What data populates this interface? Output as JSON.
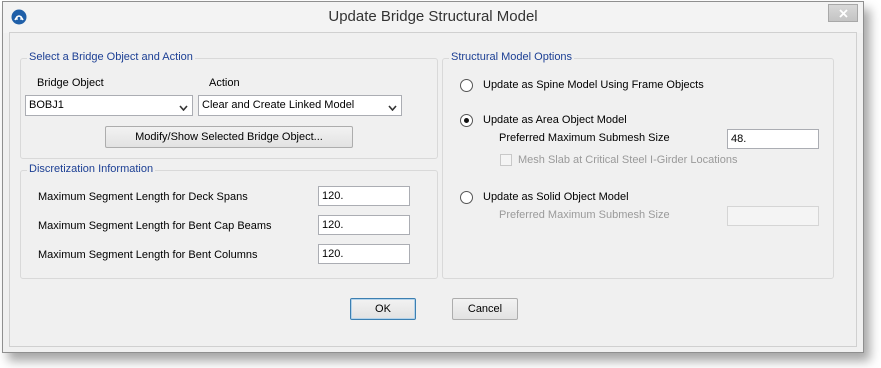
{
  "window": {
    "title": "Update Bridge Structural Model"
  },
  "select_group": {
    "legend": "Select a Bridge Object and Action",
    "bridge_object_label": "Bridge Object",
    "bridge_object_value": "BOBJ1",
    "action_label": "Action",
    "action_value": "Clear and Create Linked Model",
    "modify_button": "Modify/Show Selected Bridge Object..."
  },
  "discretization": {
    "legend": "Discretization Information",
    "rows": [
      {
        "label": "Maximum Segment Length for Deck Spans",
        "value": "120."
      },
      {
        "label": "Maximum Segment Length for Bent Cap Beams",
        "value": "120."
      },
      {
        "label": "Maximum Segment Length for Bent Columns",
        "value": "120."
      }
    ]
  },
  "options": {
    "legend": "Structural Model Options",
    "spine_label": "Update as Spine Model Using Frame Objects",
    "area_label": "Update as Area Object Model",
    "area_submesh_label": "Preferred Maximum Submesh Size",
    "area_submesh_value": "48.",
    "mesh_slab_label": "Mesh Slab at Critical Steel I-Girder Locations",
    "solid_label": "Update as Solid Object Model",
    "solid_submesh_label": "Preferred Maximum Submesh Size",
    "solid_submesh_value": "",
    "selected": "area"
  },
  "footer": {
    "ok": "OK",
    "cancel": "Cancel"
  }
}
